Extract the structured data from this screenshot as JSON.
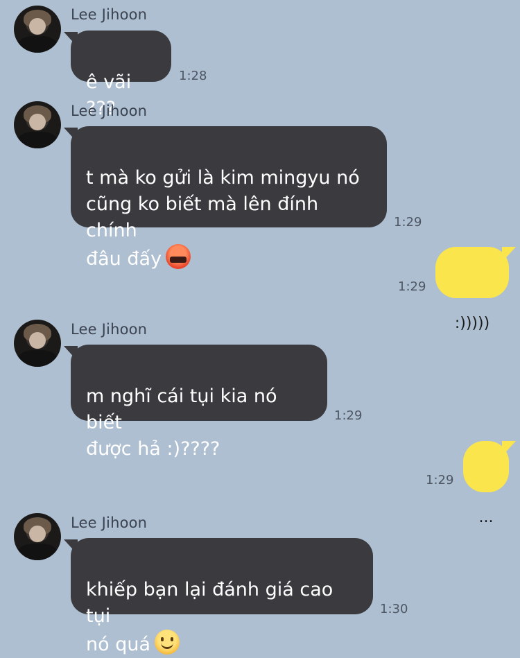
{
  "contact": {
    "name": "Lee Jihoon"
  },
  "messages": [
    {
      "from": "in",
      "text": "ê vãi ???",
      "time": "1:28"
    },
    {
      "from": "in",
      "text": "t mà ko gửi là kim mingyu nó\ncũng ko biết mà lên đính chính\nđâu đấy",
      "emoji": "angry-cursing-icon",
      "time": "1:29"
    },
    {
      "from": "out",
      "text": ":)))))",
      "time": "1:29"
    },
    {
      "from": "in",
      "text": "m nghĩ cái tụi kia nó biết\nđược hả :)????",
      "time": "1:29"
    },
    {
      "from": "out",
      "text": "...",
      "time": "1:29"
    },
    {
      "from": "in",
      "text": "khiếp bạn lại đánh giá cao tụi\nnó quá",
      "emoji": "slightly-smiling-icon",
      "time": "1:30"
    }
  ],
  "colors": {
    "background": "#aebfd1",
    "incoming_bubble": "#3b3b3f",
    "outgoing_bubble": "#fbe54d"
  }
}
